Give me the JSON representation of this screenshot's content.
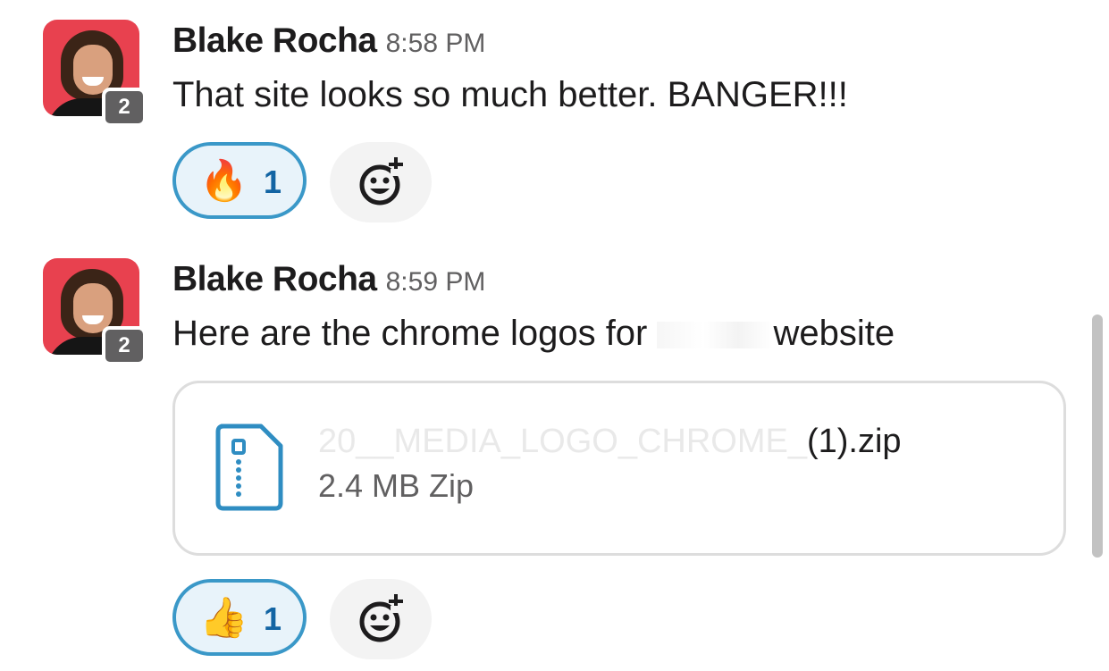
{
  "messages": [
    {
      "author": "Blake Rocha",
      "time": "8:58 PM",
      "badge": "2",
      "text": "That site looks so much better. BANGER!!!",
      "reaction": {
        "emoji": "🔥",
        "count": "1",
        "icon": "fire-emoji"
      }
    },
    {
      "author": "Blake Rocha",
      "time": "8:59 PM",
      "badge": "2",
      "text_before": "Here are the chrome logos for ",
      "text_after": "website",
      "file": {
        "name_faded": "20__MEDIA_LOGO_CHROME_",
        "name_visible": "(1).zip",
        "meta": "2.4 MB Zip",
        "icon": "zip-file-icon"
      },
      "reaction": {
        "emoji": "👍",
        "count": "1",
        "icon": "thumbs-up-emoji"
      }
    }
  ],
  "colors": {
    "reaction_border": "#3a98c8",
    "reaction_bg": "#e8f3fa",
    "reaction_count": "#1264a3",
    "avatar_bg": "#e8414f",
    "badge_bg": "#616061"
  }
}
